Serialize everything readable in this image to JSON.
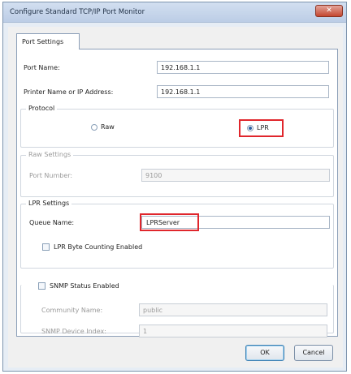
{
  "window": {
    "title": "Configure Standard TCP/IP Port Monitor",
    "close_glyph": "✕"
  },
  "tab": {
    "label": "Port Settings"
  },
  "port_name": {
    "label": "Port Name:",
    "value": "192.168.1.1"
  },
  "printer_address": {
    "label": "Printer Name or IP Address:",
    "value": "192.168.1.1"
  },
  "protocol": {
    "title": "Protocol",
    "raw_label": "Raw",
    "lpr_label": "LPR",
    "selected": "LPR"
  },
  "raw_settings": {
    "title": "Raw Settings",
    "port_number_label": "Port Number:",
    "port_number_value": "9100"
  },
  "lpr_settings": {
    "title": "LPR Settings",
    "queue_name_label": "Queue Name:",
    "queue_name_value": "LPRServer",
    "byte_counting_label": "LPR Byte Counting Enabled",
    "byte_counting_checked": false
  },
  "snmp": {
    "enabled_label": "SNMP Status Enabled",
    "enabled_checked": false,
    "community_label": "Community Name:",
    "community_value": "public",
    "device_index_label": "SNMP Device Index:",
    "device_index_value": "1"
  },
  "buttons": {
    "ok": "OK",
    "cancel": "Cancel"
  },
  "colors": {
    "highlight": "#e0262c",
    "selected_radio": "#2d5fa0"
  }
}
